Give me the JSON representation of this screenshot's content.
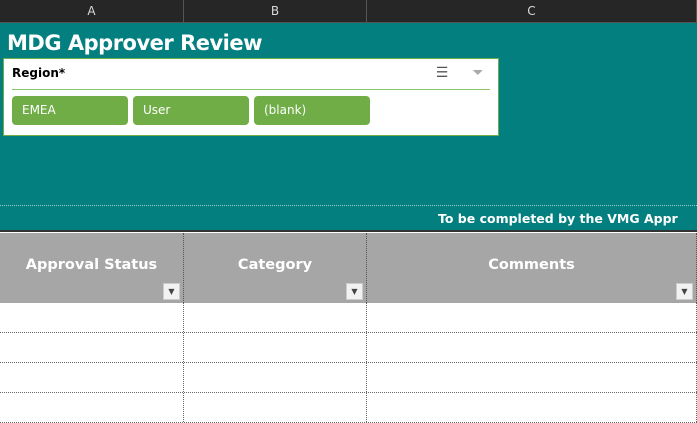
{
  "columns": [
    "A",
    "B",
    "C"
  ],
  "title": "MDG Approver Review",
  "slicer": {
    "title": "Region*",
    "items": [
      "EMEA",
      "User",
      "(blank)"
    ],
    "icons": [
      "multi-select-icon",
      "clear-filter-icon"
    ],
    "selected_color": "#70ad47"
  },
  "banner": "To be completed by the VMG Appr",
  "table": {
    "headers": [
      "Approval Status",
      "Category",
      "Comments"
    ]
  },
  "colors": {
    "teal": "#037f7f",
    "header_gray": "#a6a6a6"
  }
}
